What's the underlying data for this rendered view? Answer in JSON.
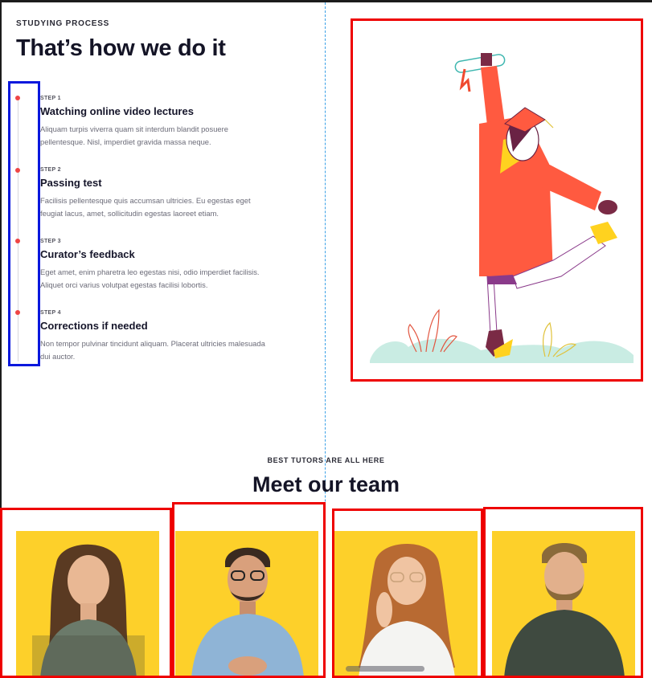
{
  "process": {
    "eyebrow": "STUDYING PROCESS",
    "title": "That’s how we do it",
    "steps": [
      {
        "label": "STEP 1",
        "title": "Watching online video lectures",
        "desc": "Aliquam turpis viverra quam sit interdum blandit posuere pellentesque. Nisl, imperdiet gravida massa neque."
      },
      {
        "label": "STEP 2",
        "title": "Passing test",
        "desc": "Facilisis pellentesque quis accumsan ultricies. Eu egestas eget feugiat lacus, amet, sollicitudin egestas laoreet etiam."
      },
      {
        "label": "STEP 3",
        "title": "Curator’s feedback",
        "desc": "Eget amet, enim pharetra leo egestas nisi, odio imperdiet facilisis. Aliquet orci varius volutpat egestas facilisi lobortis."
      },
      {
        "label": "STEP 4",
        "title": "Corrections if needed",
        "desc": "Non tempor pulvinar tincidunt aliquam. Placerat ultricies malesuada dui auctor."
      }
    ]
  },
  "hero_illustration": {
    "icon": "graduate-celebrating-illustration"
  },
  "team": {
    "eyebrow": "BEST TUTORS ARE ALL HERE",
    "title": "Meet our team",
    "members": [
      {
        "photo": "tutor-woman-dark-hair-photo"
      },
      {
        "photo": "tutor-man-glasses-photo"
      },
      {
        "photo": "tutor-woman-red-hair-photo"
      },
      {
        "photo": "tutor-man-beard-photo"
      }
    ]
  },
  "colors": {
    "accent_red": "#ef4545",
    "card_yellow": "#fdd02a",
    "heading": "#141426",
    "annotation_red": "#ee0000",
    "annotation_blue": "#0a18dd"
  }
}
